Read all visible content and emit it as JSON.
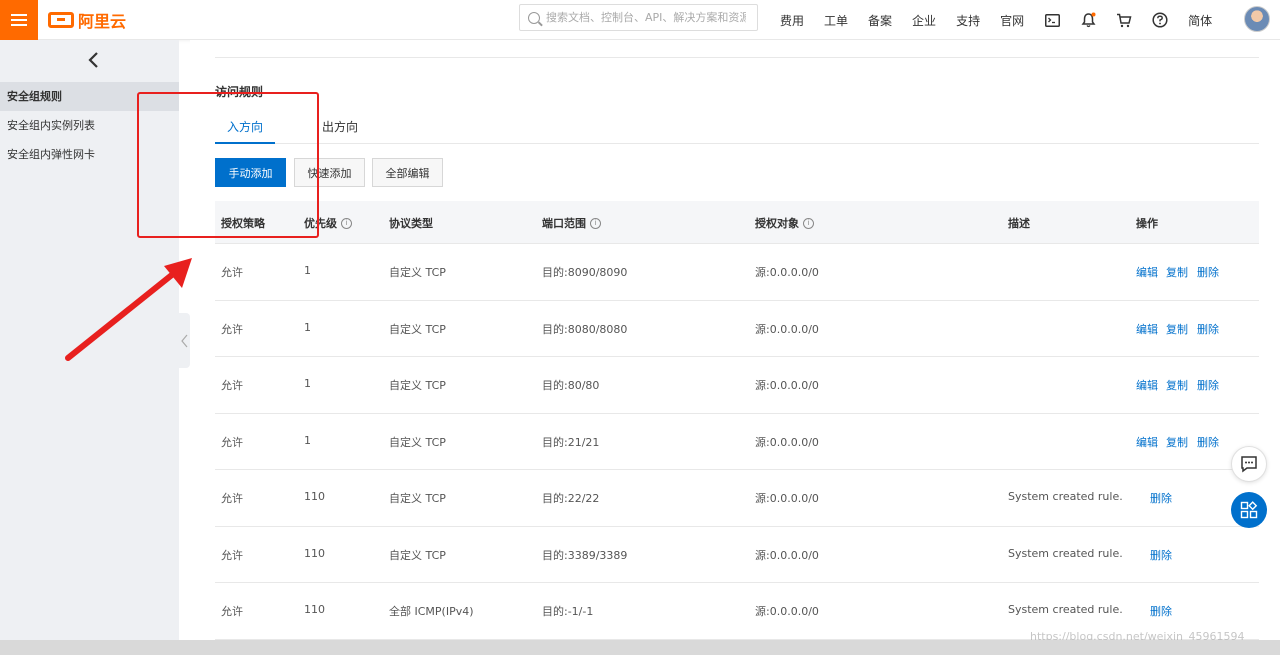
{
  "header": {
    "logo_text": "阿里云",
    "search_placeholder": "搜索文档、控制台、API、解决方案和资源",
    "nav": [
      "费用",
      "工单",
      "备案",
      "企业",
      "支持",
      "官网"
    ],
    "lang": "简体"
  },
  "sidebar": {
    "items": [
      {
        "label": "安全组规则",
        "active": true
      },
      {
        "label": "安全组内实例列表"
      },
      {
        "label": "安全组内弹性网卡"
      }
    ]
  },
  "main": {
    "section_title": "访问规则",
    "tabs": [
      "入方向",
      "出方向"
    ],
    "buttons": {
      "manual_add": "手动添加",
      "quick_add": "快速添加",
      "edit_all": "全部编辑"
    },
    "columns": [
      "授权策略",
      "优先级",
      "协议类型",
      "端口范围",
      "授权对象",
      "描述",
      "操作"
    ],
    "rows": [
      {
        "policy": "允许",
        "priority": "1",
        "protocol": "自定义 TCP",
        "port": "目的:8090/8090",
        "source": "源:0.0.0.0/0",
        "desc": "",
        "edit": "编辑",
        "copy": "复制",
        "delete": "删除"
      },
      {
        "policy": "允许",
        "priority": "1",
        "protocol": "自定义 TCP",
        "port": "目的:8080/8080",
        "source": "源:0.0.0.0/0",
        "desc": "",
        "edit": "编辑",
        "copy": "复制",
        "delete": "删除"
      },
      {
        "policy": "允许",
        "priority": "1",
        "protocol": "自定义 TCP",
        "port": "目的:80/80",
        "source": "源:0.0.0.0/0",
        "desc": "",
        "edit": "编辑",
        "copy": "复制",
        "delete": "删除"
      },
      {
        "policy": "允许",
        "priority": "1",
        "protocol": "自定义 TCP",
        "port": "目的:21/21",
        "source": "源:0.0.0.0/0",
        "desc": "",
        "edit": "编辑",
        "copy": "复制",
        "delete": "删除"
      },
      {
        "policy": "允许",
        "priority": "110",
        "protocol": "自定义 TCP",
        "port": "目的:22/22",
        "source": "源:0.0.0.0/0",
        "desc": "System created rule.",
        "delete": "删除"
      },
      {
        "policy": "允许",
        "priority": "110",
        "protocol": "自定义 TCP",
        "port": "目的:3389/3389",
        "source": "源:0.0.0.0/0",
        "desc": "System created rule.",
        "delete": "删除"
      },
      {
        "policy": "允许",
        "priority": "110",
        "protocol": "全部 ICMP(IPv4)",
        "port": "目的:-1/-1",
        "source": "源:0.0.0.0/0",
        "desc": "System created rule.",
        "delete": "删除"
      }
    ]
  },
  "watermark": "https://blog.csdn.net/weixin_45961594",
  "colors": {
    "brand": "#ff6a00",
    "link": "#0070cc",
    "annotation": "#e8201e"
  }
}
